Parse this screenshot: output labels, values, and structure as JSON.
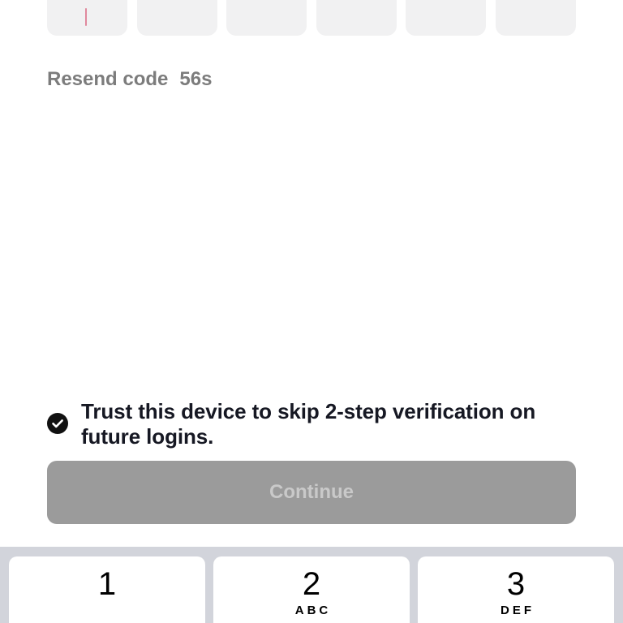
{
  "code_input": {
    "boxes": [
      "",
      "",
      "",
      "",
      "",
      ""
    ],
    "active_index": 0
  },
  "resend": {
    "label": "Resend code",
    "countdown": "56s"
  },
  "trust_device": {
    "checked": true,
    "label": "Trust this device to skip 2-step verification on future logins."
  },
  "continue_button": {
    "label": "Continue",
    "enabled": false
  },
  "keypad": {
    "keys": [
      {
        "digit": "1",
        "letters": ""
      },
      {
        "digit": "2",
        "letters": "ABC"
      },
      {
        "digit": "3",
        "letters": "DEF"
      }
    ]
  },
  "colors": {
    "caret": "#e0889d",
    "box_background": "#f1f1f2",
    "resend_text": "#7c7c7c",
    "continue_disabled_bg": "#9b9b9b",
    "continue_disabled_text": "#c9c9c9",
    "keypad_background": "#d2d4db"
  },
  "icons": {
    "trust_check": "check-circle-icon"
  }
}
